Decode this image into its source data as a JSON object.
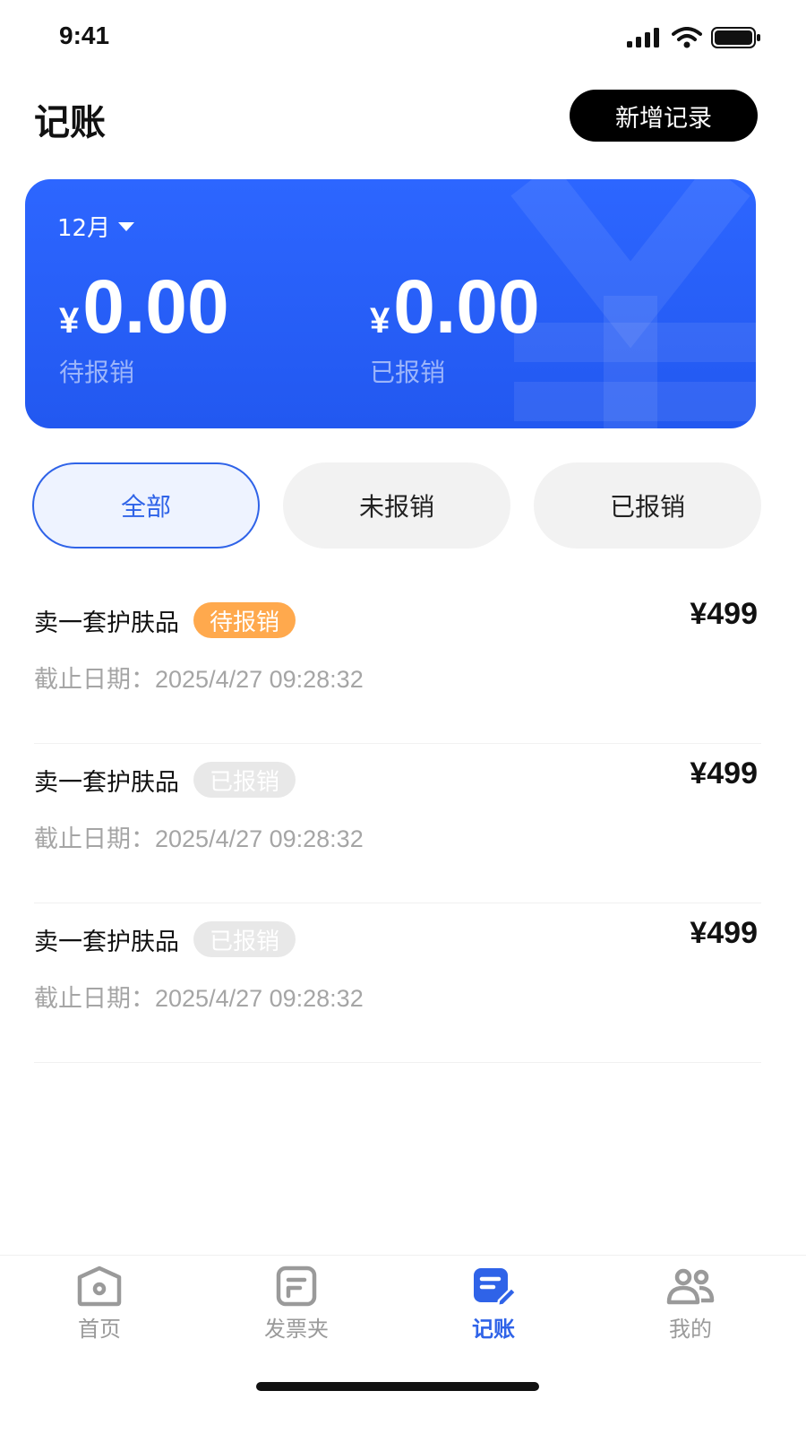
{
  "status_bar": {
    "time": "9:41"
  },
  "header": {
    "title": "记账",
    "add_button": "新增记录"
  },
  "summary": {
    "month": "12月",
    "pending": {
      "currency": "¥",
      "amount": "0.00",
      "label": "待报销"
    },
    "done": {
      "currency": "¥",
      "amount": "0.00",
      "label": "已报销"
    },
    "colors": {
      "card": "#2258f0"
    }
  },
  "filters": [
    {
      "label": "全部",
      "active": true
    },
    {
      "label": "未报销",
      "active": false
    },
    {
      "label": "已报销",
      "active": false
    }
  ],
  "records": [
    {
      "title": "卖一套护肤品",
      "status": "待报销",
      "status_type": "pending",
      "date_label": "截止日期：",
      "date": "2025/4/27 09:28:32",
      "amount": "¥499"
    },
    {
      "title": "卖一套护肤品",
      "status": "已报销",
      "status_type": "done",
      "date_label": "截止日期：",
      "date": "2025/4/27 09:28:32",
      "amount": "¥499"
    },
    {
      "title": "卖一套护肤品",
      "status": "已报销",
      "status_type": "done",
      "date_label": "截止日期：",
      "date": "2025/4/27 09:28:32",
      "amount": "¥499"
    }
  ],
  "tab_bar": [
    {
      "label": "首页",
      "icon": "home-icon",
      "active": false
    },
    {
      "label": "发票夹",
      "icon": "invoice-folder-icon",
      "active": false
    },
    {
      "label": "记账",
      "icon": "bookkeeping-icon",
      "active": true
    },
    {
      "label": "我的",
      "icon": "profile-icon",
      "active": false
    }
  ],
  "accent_color": "#2f63e8",
  "pending_badge_color": "#ffa94d"
}
